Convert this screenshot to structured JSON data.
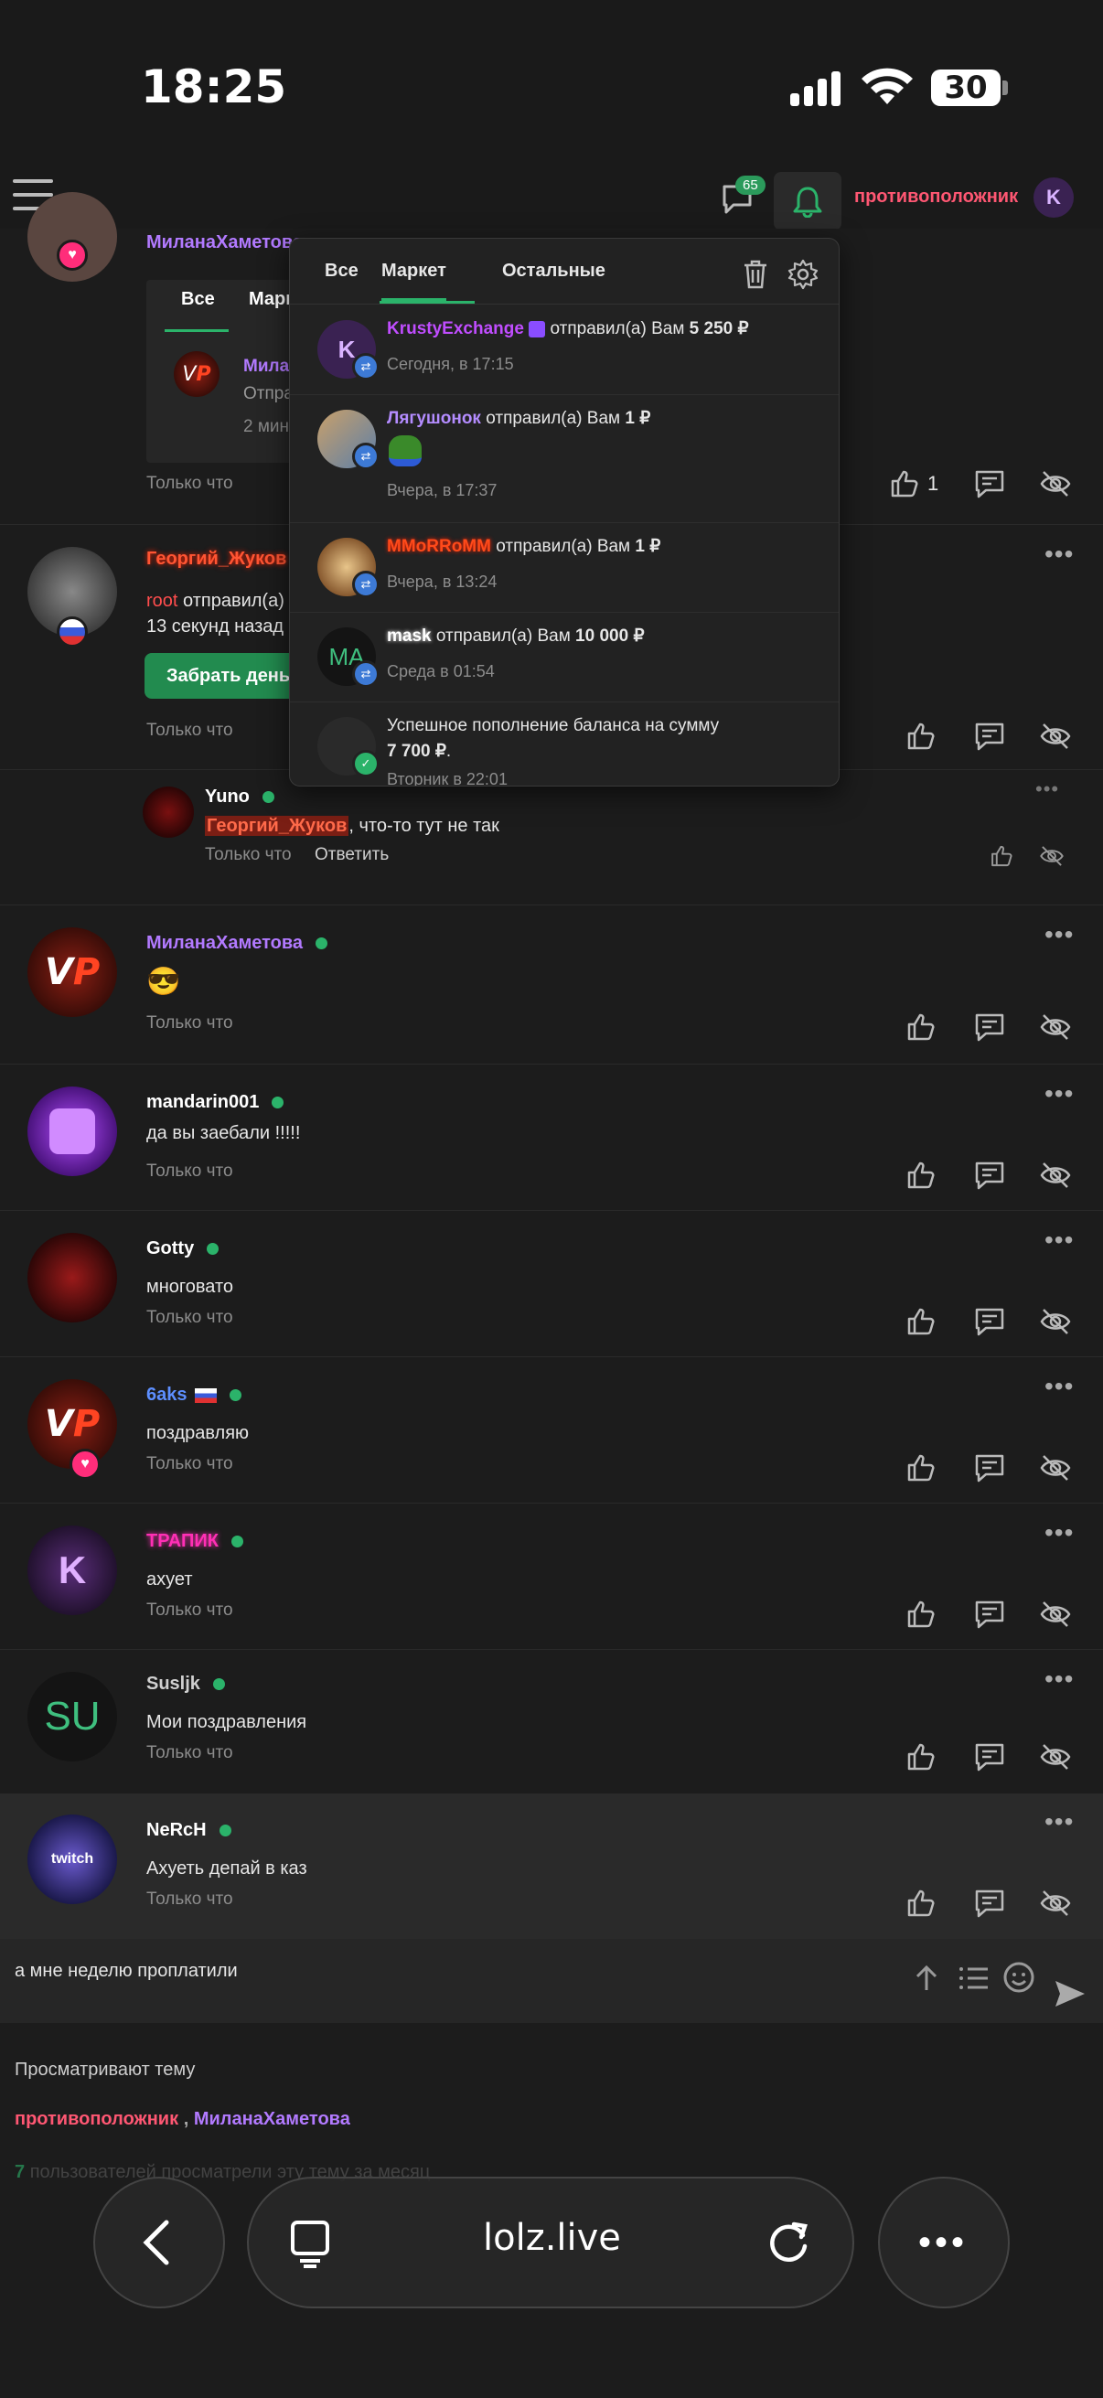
{
  "status_bar": {
    "time": "18:25",
    "battery": "30"
  },
  "topnav": {
    "chat_count": "65",
    "username": "противоположник",
    "user_avatar_letter": "K"
  },
  "notifications": {
    "tabs": [
      "Все",
      "Маркет",
      "Остальные"
    ],
    "active_tab": "Маркет",
    "items": [
      {
        "user": "KrustyExchange",
        "user_color": "#c04dff",
        "action": "отправил(а) Вам",
        "amount": "5 250 ₽",
        "time": "Сегодня, в 17:15",
        "avatar_letter": "K"
      },
      {
        "user": "Лягушонок",
        "user_color": "#b48cff",
        "action": "отправил(а) Вам",
        "amount": "1 ₽",
        "time": "Вчера, в 17:37"
      },
      {
        "user": "MMoRRoMM",
        "user_color": "#ff4a1a",
        "action": "отправил(а) Вам",
        "amount": "1 ₽",
        "time": "Вчера, в 13:24"
      },
      {
        "user": "mask",
        "user_color": "#ffffff",
        "action": "отправил(а) Вам",
        "amount": "10 000 ₽",
        "time": "Среда в 01:54",
        "avatar_letter": "MA"
      },
      {
        "text": "Успешное пополнение баланса на сумму",
        "amount": "7 700 ₽",
        "time": "Вторник в 22:01"
      }
    ]
  },
  "hidden_post": {
    "name": "МиланаХаметова",
    "inner_tabs": [
      "Все",
      "Марк"
    ],
    "inner_name": "Мила",
    "inner_sub": "Отпра",
    "inner_time": "2 мин",
    "meta": "Только что",
    "likes": "1"
  },
  "posts": [
    {
      "name": "Георгий_Жуков",
      "name_color": "#ff5533",
      "line1_user": "root",
      "line1_rest": " отправил(а)",
      "line2": "13 секунд назад",
      "button": "Забрать деньги",
      "meta": "Только что"
    },
    {
      "name": "Yuno",
      "name_color": "#ffffff",
      "mention": "Георгий_Жуков",
      "text": ", что-то тут не так",
      "meta": "Только что",
      "reply": "Ответить"
    },
    {
      "name": "МиланаХаметова",
      "name_color": "#b27aff",
      "text": "😎",
      "meta": "Только что"
    },
    {
      "name": "mandarin001",
      "name_color": "#ffffff",
      "text": "да вы заебали !!!!!",
      "meta": "Только что"
    },
    {
      "name": "Gotty",
      "name_color": "#ffffff",
      "text": "многовато",
      "meta": "Только что"
    },
    {
      "name": "6aks",
      "name_color": "#5d8fff",
      "text": "поздравляю",
      "meta": "Только что"
    },
    {
      "name": "ТРАПИК",
      "name_color": "#ff2fb5",
      "text": "ахует",
      "meta": "Только что"
    },
    {
      "name": "Susljk",
      "name_color": "#d0d0d0",
      "text": "Мои поздравления",
      "meta": "Только что",
      "avatar_letters": "SU"
    },
    {
      "name": "NeRcH",
      "name_color": "#ffffff",
      "text": "Ахуеть депай в каз",
      "meta": "Только что"
    }
  ],
  "composer": {
    "text": "а мне неделю проплатили"
  },
  "viewers": {
    "title": "Просматривают тему",
    "names": [
      {
        "name": "противоположник",
        "color": "#ff5773"
      },
      {
        "name": "МиланаХаметова",
        "color": "#b27aff"
      }
    ],
    "separator": ",",
    "count_num": "7",
    "count_text": "пользователей просматрели эту тему за месяц"
  },
  "browser": {
    "url": "lolz.live"
  },
  "colors": {
    "accent": "#2bb36a",
    "background": "#1a1a1a",
    "panel": "#222222"
  }
}
